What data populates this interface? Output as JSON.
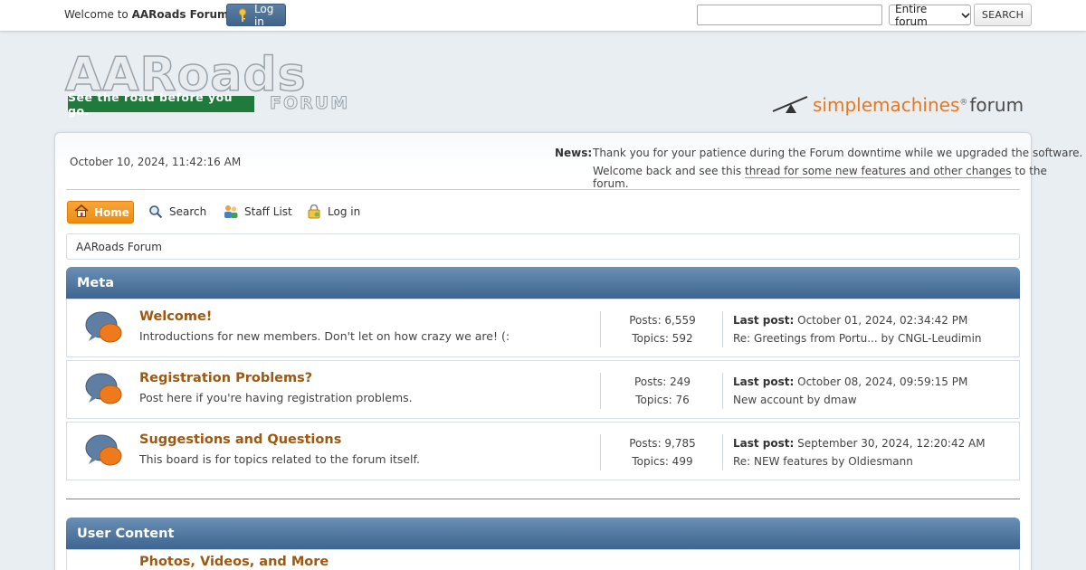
{
  "topbar": {
    "welcome_prefix": "Welcome to ",
    "welcome_site": "AARoads Forum",
    "welcome_suffix": ".",
    "login_label": "Log in",
    "search_value": "",
    "search_scope": "Entire forum",
    "search_button": "SEARCH"
  },
  "header": {
    "logo_text": "AARoads",
    "logo_tagline": "See the road before you go.",
    "logo_forum": "FORUM",
    "smf_simple": "simple",
    "smf_machines": "machines",
    "smf_reg": "®",
    "smf_forum": "forum"
  },
  "info": {
    "date": "October 10, 2024, 11:42:16 AM",
    "news_label": "News:",
    "news_line1": "Thank you for your patience during the Forum downtime while we upgraded the software.",
    "news_line2_pre": "Welcome back and see this ",
    "news_line2_link": "thread for some new features and other changes",
    "news_line2_post": " to the forum."
  },
  "menu": {
    "home": "Home",
    "search": "Search",
    "staff": "Staff List",
    "login": "Log in"
  },
  "breadcrumb": "AARoads Forum",
  "categories": [
    {
      "title": "Meta",
      "boards": [
        {
          "title": "Welcome!",
          "desc": "Introductions for new members. Don't let on how crazy we are! (:",
          "posts": "Posts: 6,559",
          "topics": "Topics: 592",
          "last_label": "Last post:",
          "last_date": " October 01, 2024, 02:34:42 PM",
          "last_topic": "Re: Greetings from Portu... by CNGL-Leudimin"
        },
        {
          "title": "Registration Problems?",
          "desc": "Post here if you're having registration problems.",
          "posts": "Posts: 249",
          "topics": "Topics: 76",
          "last_label": "Last post:",
          "last_date": " October 08, 2024, 09:59:15 PM",
          "last_topic": "New account by dmaw"
        },
        {
          "title": "Suggestions and Questions",
          "desc": "This board is for topics related to the forum itself.",
          "posts": "Posts: 9,785",
          "topics": "Topics: 499",
          "last_label": "Last post:",
          "last_date": " September 30, 2024, 12:20:42 AM",
          "last_topic": "Re: NEW features by Oldiesmann"
        }
      ]
    },
    {
      "title": "User Content",
      "boards": [
        {
          "title": "Photos, Videos, and More"
        }
      ]
    }
  ],
  "colors": {
    "accent_orange": "#ef8c10",
    "header_blue": "#3d6590",
    "board_title": "#a0570e"
  }
}
